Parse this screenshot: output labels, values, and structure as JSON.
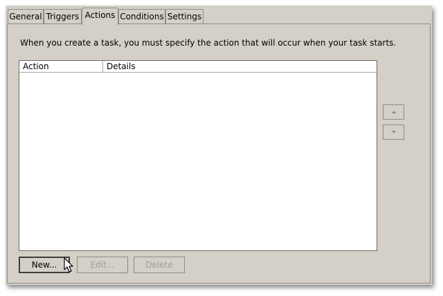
{
  "tabs": [
    {
      "label": "General",
      "active": false
    },
    {
      "label": "Triggers",
      "active": false
    },
    {
      "label": "Actions",
      "active": true
    },
    {
      "label": "Conditions",
      "active": false
    },
    {
      "label": "Settings",
      "active": false
    }
  ],
  "description": "When you create a task, you must specify the action that will occur when your task starts.",
  "list": {
    "columns": [
      "Action",
      "Details"
    ],
    "rows": []
  },
  "move_up_icon": "triangle-up-icon",
  "move_down_icon": "triangle-down-icon",
  "buttons": {
    "new": {
      "label": "New...",
      "enabled": true
    },
    "edit": {
      "label": "Edit...",
      "enabled": false
    },
    "delete": {
      "label": "Delete",
      "enabled": false
    }
  }
}
